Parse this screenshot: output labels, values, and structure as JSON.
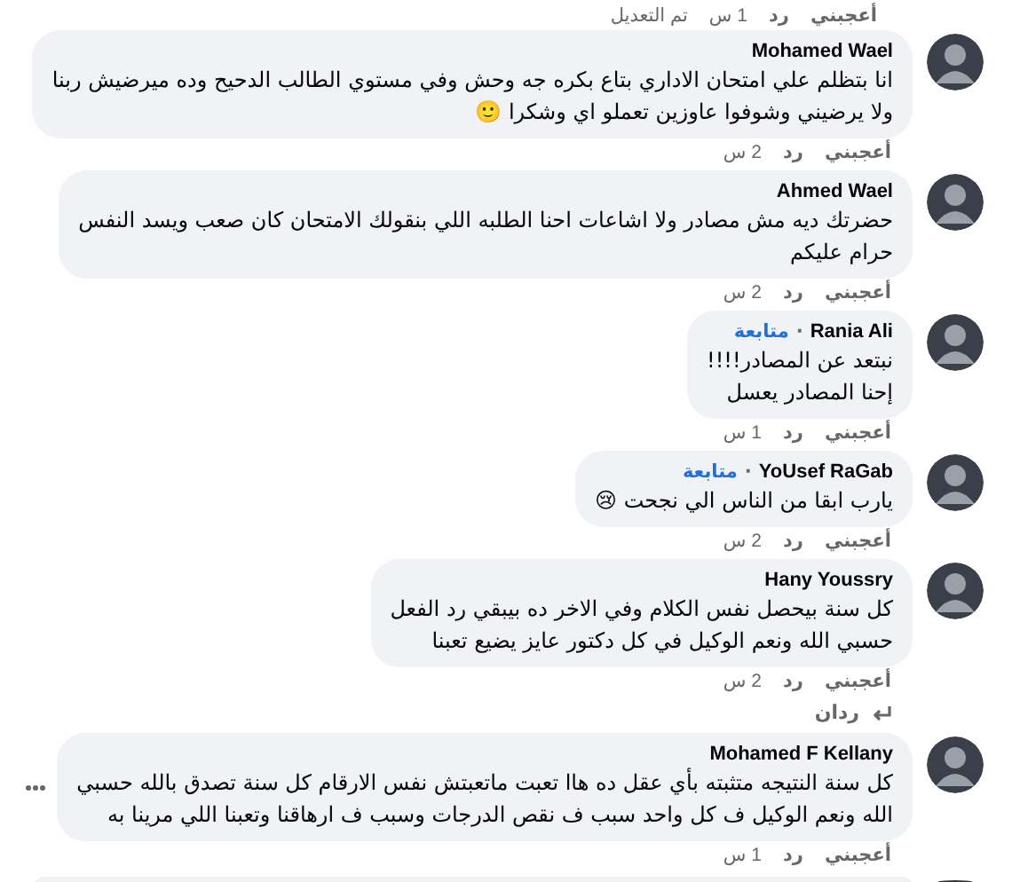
{
  "top_actions": {
    "like": "أعجبني",
    "reply": "رد",
    "time": "1 س",
    "edited": "تم التعديل"
  },
  "comments": [
    {
      "kind": "comment",
      "author": "Mohamed Wael",
      "text": "انا بتظلم علي امتحان الاداري بتاع بكره جه وحش وفي مستوي الطالب الدحيح وده ميرضيش ربنا\nولا يرضيني وشوفوا عاوزين تعملو اي وشكرا 🙂",
      "like": "أعجبني",
      "reply": "رد",
      "time": "2 س"
    },
    {
      "kind": "comment",
      "author": "Ahmed Wael",
      "text": "حضرتك ديه مش مصادر ولا اشاعات احنا الطلبه اللي بنقولك الامتحان كان صعب ويسد النفس\nحرام عليكم",
      "like": "أعجبني",
      "reply": "رد",
      "time": "2 س"
    },
    {
      "kind": "comment",
      "author": "Rania Ali",
      "dot": "·",
      "follow": "متابعة",
      "text": "نبتعد عن المصادر!!!!\nإحنا المصادر يعسل",
      "like": "أعجبني",
      "reply": "رد",
      "time": "1 س"
    },
    {
      "kind": "comment",
      "author": "YoUsef RaGab",
      "dot": "·",
      "follow": "متابعة",
      "text": "يارب ابقا من الناس الي نجحت 😢",
      "like": "أعجبني",
      "reply": "رد",
      "time": "2 س"
    },
    {
      "kind": "comment",
      "author": "Hany Youssry",
      "text": "كل سنة بيحصل نفس الكلام وفي الاخر ده بيبقي رد الفعل\nحسبي الله ونعم الوكيل في كل دكتور عايز يضيع تعبنا",
      "like": "أعجبني",
      "reply": "رد",
      "time": "2 س",
      "replies": "ردان"
    },
    {
      "kind": "comment",
      "author": "Mohamed F Kellany",
      "text": "كل سنة النتيجه متثبته بأي عقل ده هاا تعبت ماتعبتش نفس الارقام كل سنة تصدق بالله حسبي\nالله ونعم الوكيل ف كل واحد سبب ف نقص الدرجات وسبب ف ارهاقنا وتعبنا اللي مرينا به",
      "like": "أعجبني",
      "reply": "رد",
      "time": "1 س",
      "more": true
    },
    {
      "kind": "cut"
    }
  ]
}
